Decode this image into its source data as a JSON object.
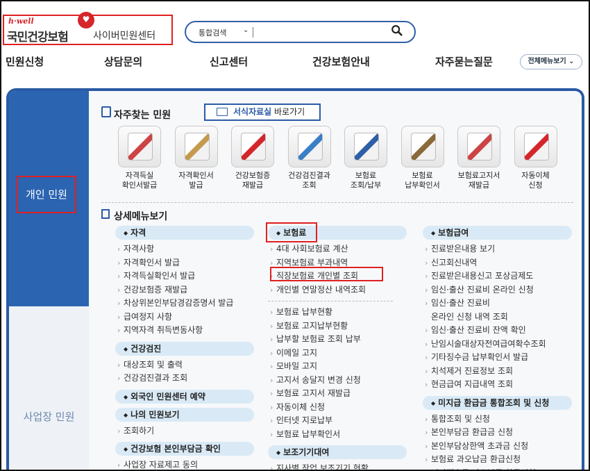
{
  "header": {
    "logo_hwell": "h·well",
    "logo_name": "국민건강보험",
    "logo_sub": "사이버민원센터",
    "search_label": "통합검색",
    "search_placeholder": ""
  },
  "gnb": [
    "민원신청",
    "상담문의",
    "신고센터",
    "건강보험안내",
    "자주묻는질문"
  ],
  "all_menu": "전체메뉴보기",
  "sidebar": {
    "personal": "개인 민원",
    "business": "사업장 민원"
  },
  "frequent": {
    "title": "자주찾는 민원",
    "form_button_hl": "서식자료실",
    "form_button_rest": " 바로가기",
    "items": [
      {
        "label": "자격득실\n확인서발급",
        "icon": "certificate-icon",
        "color": "#c44"
      },
      {
        "label": "자격확인서\n발급",
        "icon": "document-icon",
        "color": "#c59a4e"
      },
      {
        "label": "건강보험증\n재발급",
        "icon": "insurance-card-icon",
        "color": "#d4262b"
      },
      {
        "label": "건강검진결과\n조회",
        "icon": "checkup-chart-icon",
        "color": "#3a7fc6"
      },
      {
        "label": "보험료\n조회/납부",
        "icon": "payment-chart-icon",
        "color": "#2f5fa6"
      },
      {
        "label": "보험료\n납부확인서",
        "icon": "glasses-document-icon",
        "color": "#8a6a3a"
      },
      {
        "label": "보험료고지서\n재발급",
        "icon": "bill-icon",
        "color": "#c44"
      },
      {
        "label": "자동이체\n신청",
        "icon": "auto-transfer-icon",
        "color": "#d4262b"
      }
    ]
  },
  "details": {
    "title": "상세메뉴보기",
    "col1": [
      {
        "cat": "자격",
        "items": [
          "자격사항",
          "자격확인서 발급",
          "자격득실확인서 발급",
          "건강보험증 재발급",
          "차상위본인부담경감증명서 발급",
          "급여정지 사항",
          "지역자격 취득변동사항"
        ]
      },
      {
        "cat": "건강검진",
        "items": [
          "대상조회 및 출력",
          "건강검진결과 조회"
        ]
      },
      {
        "cat": "외국인 민원센터 예약",
        "items": []
      },
      {
        "cat": "나의 민원보기",
        "items": [
          "조회하기"
        ]
      },
      {
        "cat": "건강보험 본인부담금 확인",
        "items": [
          "사업장 자료제고 동의"
        ]
      }
    ],
    "col2": [
      {
        "cat": "보험료",
        "items": [
          "4대 사회보험료 계산",
          "지역보험료 부과내역",
          "직장보험료 개인별 조회",
          "개인별 연말정산 내역조회"
        ],
        "items2": [
          "보험료 납부현황",
          "보험료 고지납부현황",
          "납부할 보험료 조회 납부",
          "이메일 고지",
          "모바일 고지",
          "고지서 송달지 변경 신청",
          "보험료 고지서 재발급",
          "자동이체 신청",
          "인터넷 지로납부",
          "보험료 납부확인서"
        ]
      },
      {
        "cat": "보조기기대여",
        "items": [
          "지사별 작업 보조기기 현황"
        ]
      }
    ],
    "col3": [
      {
        "cat": "보험급여",
        "items": [
          "진료받은내용 보기",
          "신고회신내역",
          "진료받은내용신고 포상금제도",
          "임신·출산 진료비 온라인 신청",
          "임신·출산 진료비\n온라인 신청 내역 조회",
          "임신·출산 진료비 잔액 확인",
          "난임시술대상자전여급여확수조회",
          "기타징수금 납부확인서 발급",
          "치석제거 진료정보 조회",
          "현금급여 지급내역 조회"
        ]
      },
      {
        "cat": "미지급 환급금 통합조회 및 신청",
        "items": [
          "통합조회 및 신청",
          "본인부담금 환급금 신청",
          "본인부담상한액 초과금 신청",
          "보험료 과오납금 환급신청",
          "기타징수금 과오납금 환급신청"
        ]
      }
    ]
  }
}
